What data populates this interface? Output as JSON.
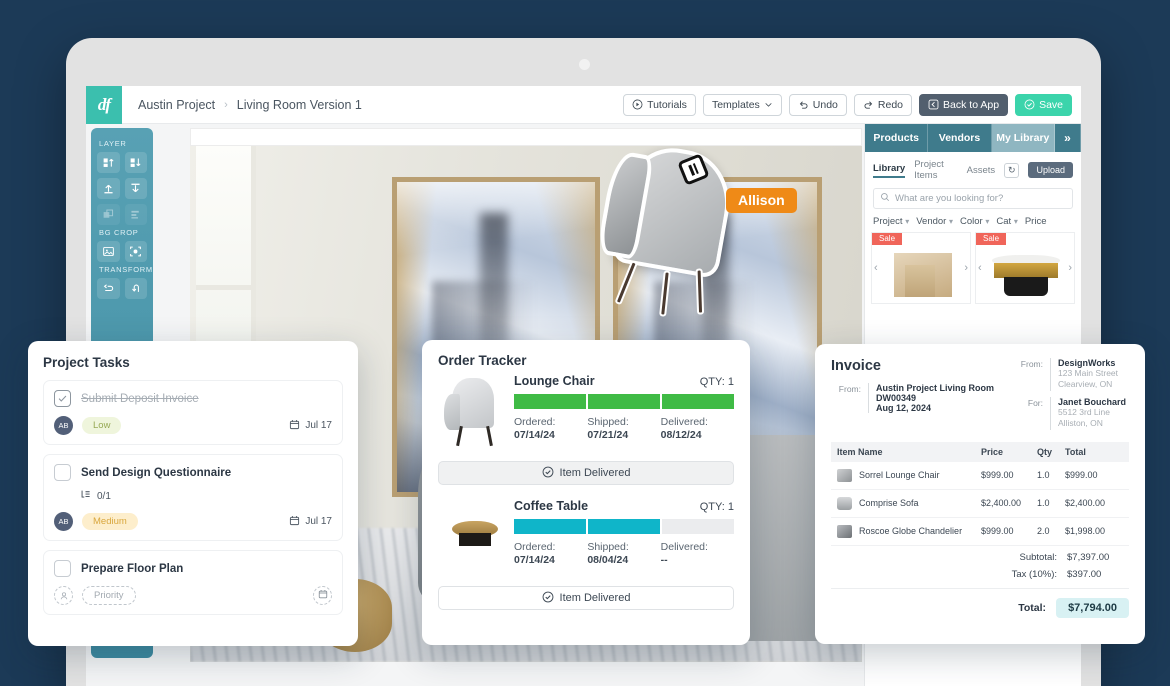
{
  "theme": {
    "bg": "#1c3a57",
    "brand_teal": "#3bbfae",
    "accent_green": "#3bd4ab",
    "panel_blue": "#3f7b8c",
    "cursor_orange": "#ef8a17"
  },
  "appbar": {
    "logo": "df",
    "breadcrumb": {
      "project": "Austin Project",
      "separator": "›",
      "version": "Living Room Version 1"
    },
    "buttons": [
      {
        "label": "Tutorials",
        "icon": "play-circle-icon"
      },
      {
        "label": "Templates",
        "icon": "chevron-down-icon"
      },
      {
        "label": "Undo",
        "icon": "undo-icon"
      },
      {
        "label": "Redo",
        "icon": "redo-icon"
      },
      {
        "label": "Back to App",
        "icon": "back-arrow-icon"
      },
      {
        "label": "Save",
        "icon": "check-circle-icon"
      }
    ]
  },
  "left_toolbar": {
    "groups": [
      {
        "title": "LAYER",
        "tools": [
          "bring-forward-icon",
          "send-backward-icon",
          "move-up-icon",
          "move-down-icon",
          "group-icon",
          "align-icon"
        ]
      },
      {
        "title": "BG CROP",
        "tools": [
          "image-crop-icon",
          "focus-crop-icon"
        ]
      },
      {
        "title": "TRANSFORM",
        "tools": [
          "flip-horizontal-icon",
          "flip-vertical-icon"
        ]
      }
    ]
  },
  "library": {
    "tabs": [
      {
        "label": "Products",
        "active": false
      },
      {
        "label": "Vendors",
        "active": false
      },
      {
        "label": "My Library",
        "active": true
      }
    ],
    "expand_icon": "»",
    "subtabs": [
      "Library",
      "Project Items",
      "Assets"
    ],
    "refresh_icon": "refresh-icon",
    "upload_label": "Upload",
    "search_placeholder": "What are you looking for?",
    "filters": [
      "Project",
      "Vendor",
      "Color",
      "Cat",
      "Price"
    ],
    "cards": [
      {
        "badge": "Sale",
        "item": "travertine-side-table"
      },
      {
        "badge": "Sale",
        "item": "brass-black-coffee-table"
      }
    ]
  },
  "canvas": {
    "collaborator": {
      "name": "Allison",
      "cursor": "drag-cursor-icon"
    }
  },
  "tasks": {
    "title": "Project Tasks",
    "items": [
      {
        "title": "Submit Deposit Invoice",
        "completed": true,
        "assignee": "AB",
        "priority": "Low",
        "priority_style": "low",
        "due": "Jul 17",
        "subtasks": null
      },
      {
        "title": "Send Design Questionnaire",
        "completed": false,
        "assignee": "AB",
        "priority": "Medium",
        "priority_style": "med",
        "due": "Jul 17",
        "subtasks": "0/1"
      },
      {
        "title": "Prepare Floor Plan",
        "completed": false,
        "assignee": "",
        "priority": "Priority",
        "priority_style": "ghost",
        "due": "",
        "subtasks": null
      }
    ]
  },
  "order_tracker": {
    "title": "Order Tracker",
    "column_labels": {
      "ordered": "Ordered:",
      "shipped": "Shipped:",
      "delivered": "Delivered:"
    },
    "qty_label": "QTY:",
    "action_label": "Item Delivered",
    "orders": [
      {
        "name": "Lounge Chair",
        "qty": "1",
        "progress": 3,
        "bar_color": "green",
        "ordered": "07/14/24",
        "shipped": "07/21/24",
        "delivered": "08/12/24",
        "action_filled": true
      },
      {
        "name": "Coffee Table",
        "qty": "1",
        "progress": 2,
        "bar_color": "teal",
        "ordered": "07/14/24",
        "shipped": "08/04/24",
        "delivered": "--",
        "action_filled": false
      }
    ]
  },
  "invoice": {
    "title": "Invoice",
    "from_label": "From:",
    "for_label": "For:",
    "project": {
      "name": "Austin Project Living Room",
      "number": "DW00349",
      "date": "Aug 12, 2024"
    },
    "company": {
      "name": "DesignWorks",
      "address1": "123 Main Street",
      "address2": "Clearview, ON"
    },
    "client": {
      "name": "Janet Bouchard",
      "address1": "5512 3rd Line",
      "address2": "Alliston, ON"
    },
    "columns": [
      "Item Name",
      "Price",
      "Qty",
      "Total"
    ],
    "rows": [
      {
        "name": "Sorrel Lounge Chair",
        "price": "$999.00",
        "qty": "1.0",
        "total": "$999.00"
      },
      {
        "name": "Comprise Sofa",
        "price": "$2,400.00",
        "qty": "1.0",
        "total": "$2,400.00"
      },
      {
        "name": "Roscoe Globe Chandelier",
        "price": "$999.00",
        "qty": "2.0",
        "total": "$1,998.00"
      }
    ],
    "subtotal_label": "Subtotal:",
    "subtotal_value": "$7,397.00",
    "tax_label": "Tax (10%):",
    "tax_value": "$397.00",
    "total_label": "Total:",
    "total_value": "$7,794.00"
  }
}
